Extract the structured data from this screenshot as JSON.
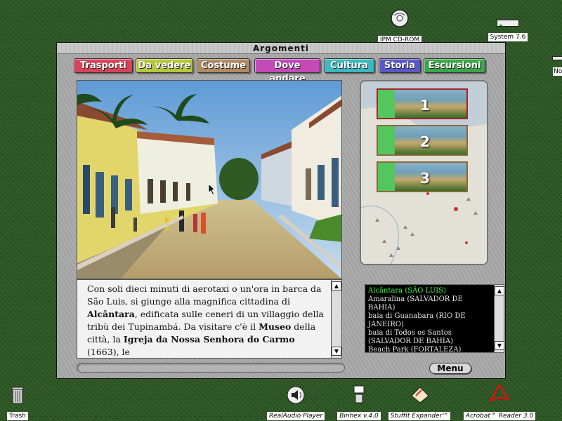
{
  "desktop": {
    "icons": {
      "cdrom": "IPM CD-ROM",
      "system": "System 7.6",
      "partial": "Nor",
      "trash": "Trash",
      "realaudio": "RealAudio Player",
      "binhex": "Binhex v.4.0",
      "stuffit": "StuffIt Expander™",
      "acrobat": "Acrobat™ Reader 3.0"
    }
  },
  "window": {
    "title": "Argomenti",
    "tabs": [
      {
        "label": "Trasporti",
        "color": "#d9435a"
      },
      {
        "label": "Da vedere",
        "color": "#b6c83a"
      },
      {
        "label": "Costume",
        "color": "#b08a64"
      },
      {
        "label": "Dove andare",
        "color": "#c44ab8"
      },
      {
        "label": "Cultura",
        "color": "#3cb8c0"
      },
      {
        "label": "Storia",
        "color": "#5a58c8"
      },
      {
        "label": "Escursioni",
        "color": "#3aa84a"
      }
    ]
  },
  "article": {
    "p1": " Con soli dieci minuti di aerotaxi o un'ora in barca da São Luis, si giunge alla magnifica cittadina di ",
    "b1": "Alcântara",
    "p2": ", edificata sulle ceneri di un villaggio della tribù dei Tupinambá. Da visitare c'è il ",
    "b2": "Museo",
    "p3": " della città, la ",
    "b3": "Igreja da Nossa Senhora do Carmo",
    "p4": " (1663), le"
  },
  "thumbnails": [
    "1",
    "2",
    "3"
  ],
  "places": [
    "Alcântara (SÃO LUIS)",
    "Amaralina (SALVADOR DE BAHIA)",
    "baia di Guanabara (RIO DE JANEIRO)",
    "baia di Todos os Santos (SALVADOR DE BAHIA)",
    "Beach Park (FORTALEZA)"
  ],
  "menu_label": "Menu",
  "scroll_up": "▲",
  "scroll_down": "▼"
}
